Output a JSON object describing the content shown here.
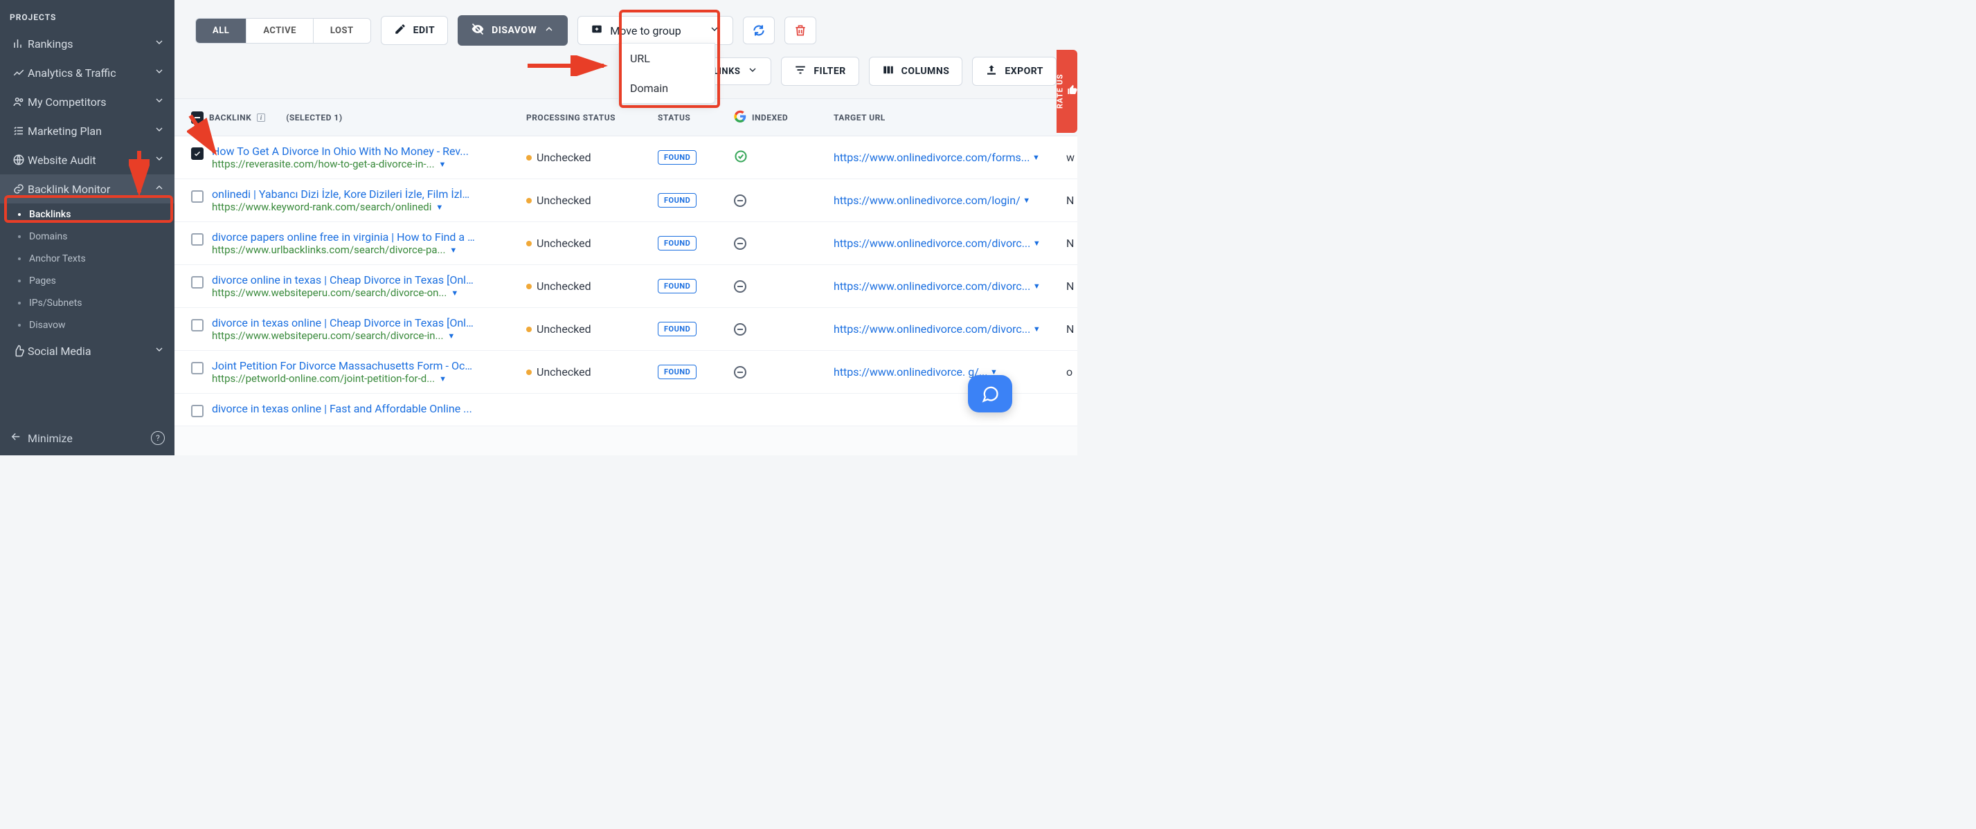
{
  "sidebar": {
    "title": "PROJECTS",
    "items": [
      {
        "label": "Rankings"
      },
      {
        "label": "Analytics & Traffic"
      },
      {
        "label": "My Competitors"
      },
      {
        "label": "Marketing Plan"
      },
      {
        "label": "Website Audit"
      },
      {
        "label": "Backlink Monitor"
      },
      {
        "label": "Social Media"
      }
    ],
    "sub_items": [
      {
        "label": "Backlinks"
      },
      {
        "label": "Domains"
      },
      {
        "label": "Anchor Texts"
      },
      {
        "label": "Pages"
      },
      {
        "label": "IPs/Subnets"
      },
      {
        "label": "Disavow"
      }
    ],
    "minimize": "Minimize"
  },
  "toolbar": {
    "segments": {
      "all": "ALL",
      "active": "ACTIVE",
      "lost": "LOST"
    },
    "edit": "EDIT",
    "disavow": "DISAVOW",
    "move_group": "Move to group",
    "all_backlinks": "ALL BACKLINKS",
    "filter": "FILTER",
    "columns": "COLUMNS",
    "export": "EXPORT"
  },
  "disavow_menu": {
    "url": "URL",
    "domain": "Domain"
  },
  "table": {
    "headers": {
      "backlink": "BACKLINK",
      "selected": "(SELECTED 1)",
      "processing": "PROCESSING STATUS",
      "status": "STATUS",
      "indexed": "INDEXED",
      "target": "TARGET URL"
    },
    "rows": [
      {
        "checked": true,
        "title": "How To Get A Divorce In Ohio With No Money - Rev...",
        "url": "https://reverasite.com/how-to-get-a-divorce-in-...",
        "processing": "Unchecked",
        "status": "FOUND",
        "indexed": "ok",
        "target": "https://www.onlinedivorce.com/forms...",
        "tail": "w"
      },
      {
        "checked": false,
        "title": "onlinedi | Yabancı Dizi İzle, Kore Dizileri İzle, Film İzle,...",
        "url": "https://www.keyword-rank.com/search/onlinedi",
        "processing": "Unchecked",
        "status": "FOUND",
        "indexed": "no",
        "target": "https://www.onlinedivorce.com/login/",
        "tail": "N"
      },
      {
        "checked": false,
        "title": "divorce papers online free in virginia | How to Find a ...",
        "url": "https://www.urlbacklinks.com/search/divorce-pa...",
        "processing": "Unchecked",
        "status": "FOUND",
        "indexed": "no",
        "target": "https://www.onlinedivorce.com/divorc...",
        "tail": "N"
      },
      {
        "checked": false,
        "title": "divorce online in texas | Cheap Divorce in Texas [Onli...",
        "url": "https://www.websiteperu.com/search/divorce-on...",
        "processing": "Unchecked",
        "status": "FOUND",
        "indexed": "no",
        "target": "https://www.onlinedivorce.com/divorc...",
        "tail": "N"
      },
      {
        "checked": false,
        "title": "divorce in texas online | Cheap Divorce in Texas [Onli...",
        "url": "https://www.websiteperu.com/search/divorce-in...",
        "processing": "Unchecked",
        "status": "FOUND",
        "indexed": "no",
        "target": "https://www.onlinedivorce.com/divorc...",
        "tail": "N"
      },
      {
        "checked": false,
        "title": "Joint Petition For Divorce Massachusetts Form - Oct...",
        "url": "https://petworld-online.com/joint-petition-for-d...",
        "processing": "Unchecked",
        "status": "FOUND",
        "indexed": "no",
        "target": "https://www.onlinedivorce.       g/...",
        "tail": "o"
      },
      {
        "checked": false,
        "title": "divorce in texas online | Fast and Affordable Online ...",
        "url": "",
        "processing": "",
        "status": "",
        "indexed": "",
        "target": "",
        "tail": ""
      }
    ]
  },
  "rate_us": "RATE US"
}
